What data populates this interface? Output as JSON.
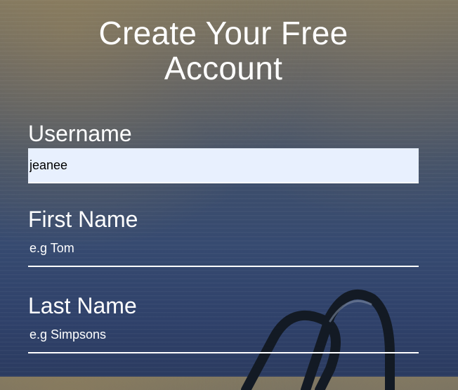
{
  "form": {
    "title_line1": "Create Your Free",
    "title_line2": "Account",
    "fields": [
      {
        "label": "Username",
        "value": "jeanee",
        "placeholder": ""
      },
      {
        "label": "First Name",
        "value": "",
        "placeholder": "e.g Tom"
      },
      {
        "label": "Last Name",
        "value": "",
        "placeholder": "e.g Simpsons"
      }
    ]
  },
  "colors": {
    "input_fill": "#e8f0fe",
    "text": "#ffffff",
    "background_top": "#7b7563",
    "background_bottom": "#2b3b60"
  }
}
